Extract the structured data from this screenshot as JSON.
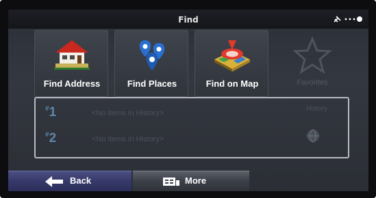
{
  "header": {
    "title": "Find",
    "status_icons": [
      "satellite-icon",
      "signal-dots-icon"
    ]
  },
  "tiles": [
    {
      "label": "Find Address",
      "icon": "house-icon",
      "enabled": true
    },
    {
      "label": "Find Places",
      "icon": "poi-pins-icon",
      "enabled": true
    },
    {
      "label": "Find on Map",
      "icon": "map-target-icon",
      "enabled": true
    },
    {
      "label": "Favorites",
      "icon": "star-icon",
      "enabled": false
    }
  ],
  "history": {
    "label": "History",
    "items": [
      {
        "number": "1",
        "text": "<No items in History>"
      },
      {
        "number": "2",
        "text": "<No items in History>"
      }
    ],
    "icon": "globe-icon"
  },
  "bottom": {
    "back_label": "Back",
    "more_label": "More"
  },
  "colors": {
    "accent_blue": "#5f86a8",
    "back_button": "#36396a",
    "text_disabled": "#4e5259"
  }
}
